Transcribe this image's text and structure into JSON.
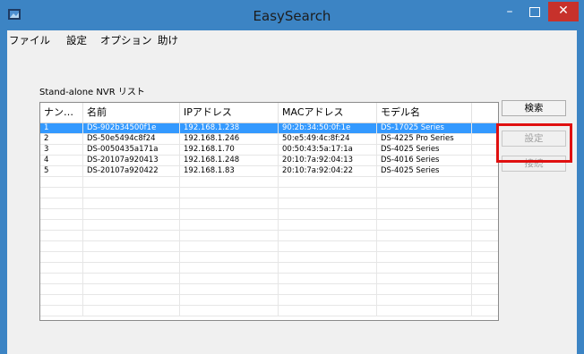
{
  "window": {
    "title": "EasySearch",
    "minimize_glyph": "–",
    "close_glyph": "✕"
  },
  "menu": [
    "ファイル",
    "設定",
    "オプション",
    "助け"
  ],
  "group_label": "Stand-alone NVR リスト",
  "columns": [
    "ナン…",
    "名前",
    "IPアドレス",
    "MACアドレス",
    "モデル名"
  ],
  "rows": [
    {
      "num": "1",
      "name": "DS-902b34500f1e",
      "ip": "192.168.1.238",
      "mac": "90:2b:34:50:0f:1e",
      "model": "DS-17025 Series",
      "selected": true
    },
    {
      "num": "2",
      "name": "DS-50e5494c8f24",
      "ip": "192.168.1.246",
      "mac": "50:e5:49:4c:8f:24",
      "model": "DS-4225 Pro Series",
      "selected": false
    },
    {
      "num": "3",
      "name": "DS-0050435a171a",
      "ip": "192.168.1.70",
      "mac": "00:50:43:5a:17:1a",
      "model": "DS-4025 Series",
      "selected": false
    },
    {
      "num": "4",
      "name": "DS-20107a920413",
      "ip": "192.168.1.248",
      "mac": "20:10:7a:92:04:13",
      "model": "DS-4016 Series",
      "selected": false
    },
    {
      "num": "5",
      "name": "DS-20107a920422",
      "ip": "192.168.1.83",
      "mac": "20:10:7a:92:04:22",
      "model": "DS-4025 Series",
      "selected": false
    }
  ],
  "buttons": {
    "search": "検索",
    "settings": "設定",
    "connect": "接続"
  },
  "colors": {
    "titlebar": "#3c84c4",
    "selection": "#3399ff",
    "highlight_box": "#e01010",
    "close_button": "#c7312b"
  }
}
